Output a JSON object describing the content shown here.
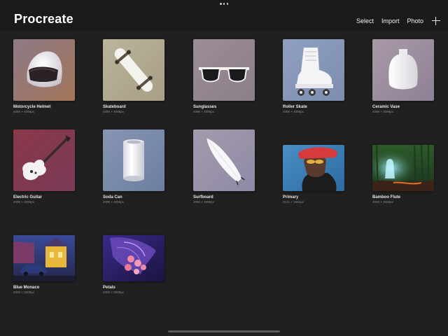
{
  "app": {
    "title": "Procreate"
  },
  "toolbar": {
    "select_label": "Select",
    "import_label": "Import",
    "photo_label": "Photo",
    "add_icon": "plus-icon"
  },
  "gallery": {
    "items": [
      {
        "title": "Motorcycle Helmet",
        "size": "4096 × 4096px"
      },
      {
        "title": "Skateboard",
        "size": "4096 × 4096px"
      },
      {
        "title": "Sunglasses",
        "size": "4096 × 4096px"
      },
      {
        "title": "Roller Skate",
        "size": "4096 × 4096px"
      },
      {
        "title": "Ceramic Vase",
        "size": "4096 × 4096px"
      },
      {
        "title": "Electric Guitar",
        "size": "4096 × 4096px"
      },
      {
        "title": "Soda Can",
        "size": "4096 × 4096px"
      },
      {
        "title": "Surfboard",
        "size": "4096 × 4096px"
      },
      {
        "title": "Primary",
        "size": "2121 × 1591px"
      },
      {
        "title": "Bamboo Flute",
        "size": "4000 × 3000px"
      },
      {
        "title": "Blue Monaco",
        "size": "4000 × 3000px"
      },
      {
        "title": "Petals",
        "size": "4000 × 5000px"
      }
    ]
  },
  "colors": {
    "background": "#202020",
    "header": "#1a1a1a",
    "title_text": "#ffffff",
    "secondary_text": "#8a8a8a"
  }
}
